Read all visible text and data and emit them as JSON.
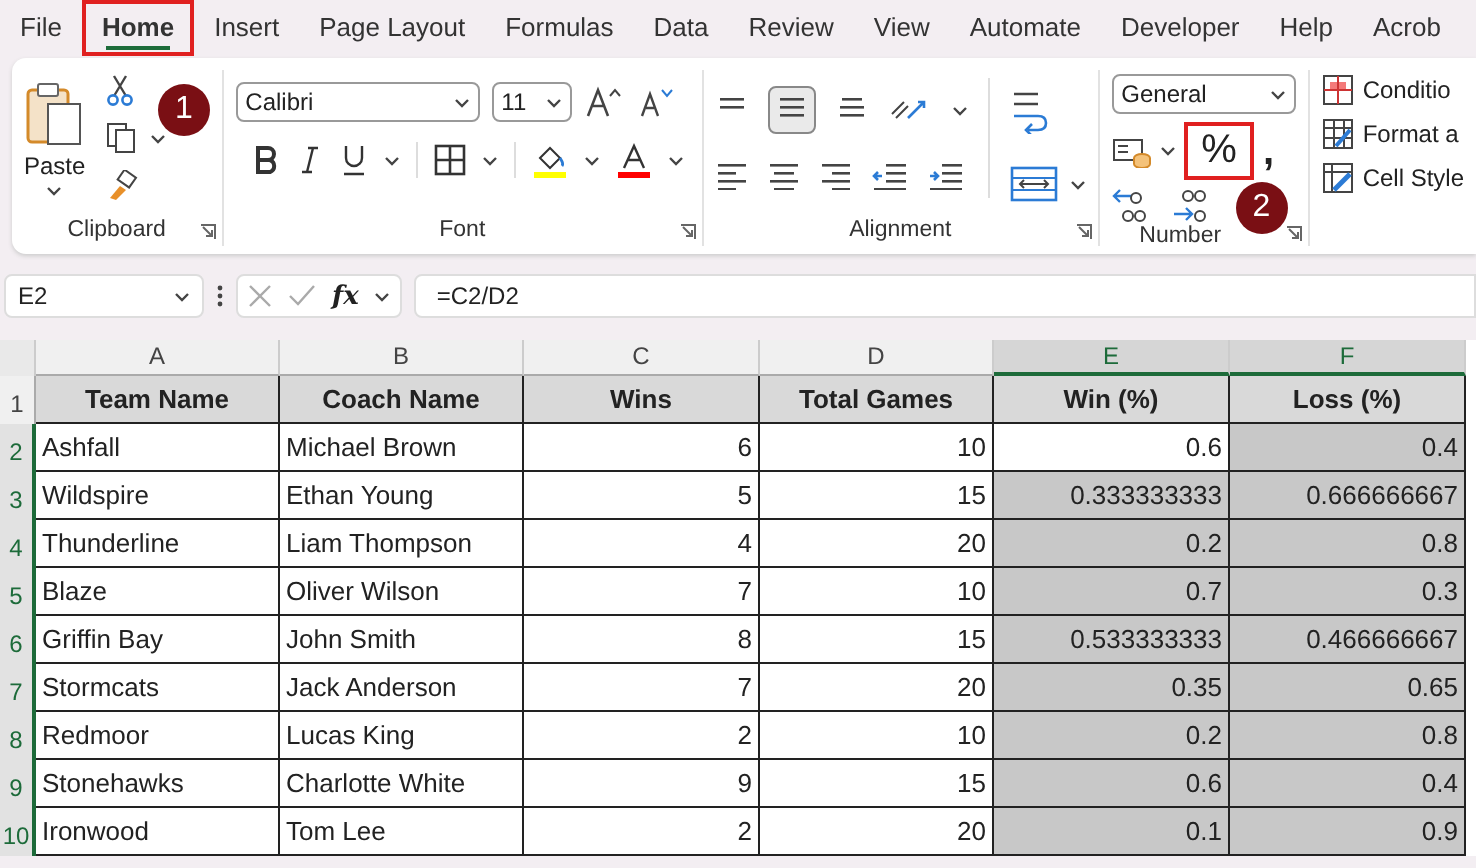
{
  "menu_tabs": [
    {
      "label": "File",
      "selected": false,
      "highlighted": false
    },
    {
      "label": "Home",
      "selected": true,
      "highlighted": true
    },
    {
      "label": "Insert",
      "selected": false,
      "highlighted": false
    },
    {
      "label": "Page Layout",
      "selected": false,
      "highlighted": false
    },
    {
      "label": "Formulas",
      "selected": false,
      "highlighted": false
    },
    {
      "label": "Data",
      "selected": false,
      "highlighted": false
    },
    {
      "label": "Review",
      "selected": false,
      "highlighted": false
    },
    {
      "label": "View",
      "selected": false,
      "highlighted": false
    },
    {
      "label": "Automate",
      "selected": false,
      "highlighted": false
    },
    {
      "label": "Developer",
      "selected": false,
      "highlighted": false
    },
    {
      "label": "Help",
      "selected": false,
      "highlighted": false
    },
    {
      "label": "Acrob",
      "selected": false,
      "highlighted": false
    }
  ],
  "ribbon": {
    "clipboard": {
      "label": "Clipboard",
      "paste": "Paste",
      "badge": "1"
    },
    "font": {
      "label": "Font",
      "font_name": "Calibri",
      "font_size": "11"
    },
    "alignment": {
      "label": "Alignment"
    },
    "number": {
      "label": "Number",
      "format": "General",
      "percent": "%",
      "percent_highlighted": true,
      "comma": ",",
      "badge": "2"
    },
    "styles": {
      "items": [
        "Conditio",
        "Format a",
        "Cell Style"
      ]
    }
  },
  "formula_bar": {
    "name_box": "E2",
    "fx": "fx",
    "formula": "=C2/D2"
  },
  "sheet": {
    "columns": [
      {
        "label": "A",
        "kind": "text",
        "selected": false
      },
      {
        "label": "B",
        "kind": "text",
        "selected": false
      },
      {
        "label": "C",
        "kind": "number",
        "selected": false
      },
      {
        "label": "D",
        "kind": "number",
        "selected": false
      },
      {
        "label": "E",
        "kind": "number",
        "selected": true
      },
      {
        "label": "F",
        "kind": "number",
        "selected": true
      }
    ],
    "rows": [
      {
        "number": "1",
        "kind": "header",
        "selected": false,
        "cells": [
          "Team Name",
          "Coach Name",
          "Wins",
          "Total Games",
          "Win (%)",
          "Loss (%)"
        ]
      },
      {
        "number": "2",
        "kind": "data",
        "selected": true,
        "cells": [
          "Ashfall",
          "Michael Brown",
          "6",
          "10",
          "0.6",
          "0.4"
        ],
        "has_active_cell": true
      },
      {
        "number": "3",
        "kind": "data",
        "selected": true,
        "cells": [
          "Wildspire",
          "Ethan Young",
          "5",
          "15",
          "0.333333333",
          "0.666666667"
        ]
      },
      {
        "number": "4",
        "kind": "data",
        "selected": true,
        "cells": [
          "Thunderline",
          "Liam Thompson",
          "4",
          "20",
          "0.2",
          "0.8"
        ]
      },
      {
        "number": "5",
        "kind": "data",
        "selected": true,
        "cells": [
          "Blaze",
          "Oliver Wilson",
          "7",
          "10",
          "0.7",
          "0.3"
        ]
      },
      {
        "number": "6",
        "kind": "data",
        "selected": true,
        "cells": [
          "Griffin Bay",
          "John Smith",
          "8",
          "15",
          "0.533333333",
          "0.466666667"
        ]
      },
      {
        "number": "7",
        "kind": "data",
        "selected": true,
        "cells": [
          "Stormcats",
          "Jack Anderson",
          "7",
          "20",
          "0.35",
          "0.65"
        ]
      },
      {
        "number": "8",
        "kind": "data",
        "selected": true,
        "cells": [
          "Redmoor",
          "Lucas King",
          "2",
          "10",
          "0.2",
          "0.8"
        ]
      },
      {
        "number": "9",
        "kind": "data",
        "selected": true,
        "cells": [
          "Stonehawks",
          "Charlotte White",
          "9",
          "15",
          "0.6",
          "0.4"
        ]
      },
      {
        "number": "10",
        "kind": "data",
        "selected": true,
        "cells": [
          "Ironwood",
          "Tom Lee",
          "2",
          "20",
          "0.1",
          "0.9"
        ]
      }
    ]
  }
}
